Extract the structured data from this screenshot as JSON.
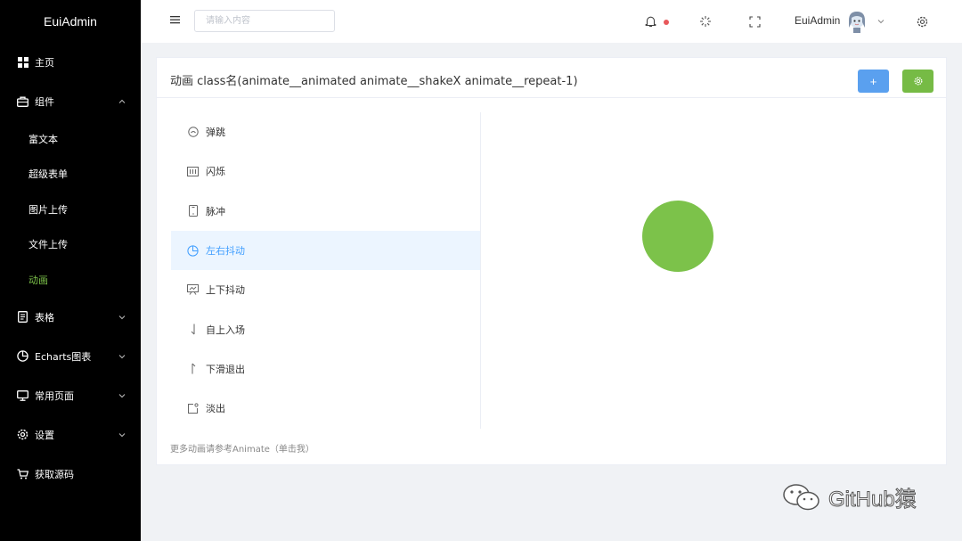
{
  "app": {
    "logo": "EuiAdmin"
  },
  "sidebar": {
    "items": [
      {
        "label": "主页",
        "icon": "home-grid-icon"
      },
      {
        "label": "组件",
        "icon": "briefcase-icon",
        "expanded": true,
        "children": [
          {
            "label": "富文本"
          },
          {
            "label": "超级表单"
          },
          {
            "label": "图片上传"
          },
          {
            "label": "文件上传"
          },
          {
            "label": "动画",
            "active": true
          }
        ]
      },
      {
        "label": "表格",
        "icon": "document-icon"
      },
      {
        "label": "Echarts图表",
        "icon": "pie-chart-icon"
      },
      {
        "label": "常用页面",
        "icon": "monitor-icon"
      },
      {
        "label": "设置",
        "icon": "gear-icon"
      },
      {
        "label": "获取源码",
        "icon": "cart-icon"
      }
    ],
    "active_color": "#7cc24a"
  },
  "header": {
    "search_placeholder": "请输入内容",
    "username": "EuiAdmin",
    "notification_dot_color": "#e8585b"
  },
  "card": {
    "title": "动画 class名(animate__animated animate__shakeX animate__repeat-1)",
    "add_button": "+",
    "list": [
      {
        "label": "弹跳",
        "icon": "smile-icon"
      },
      {
        "label": "闪烁",
        "icon": "barcode-icon"
      },
      {
        "label": "脉冲",
        "icon": "phone-icon"
      },
      {
        "label": "左右抖动",
        "icon": "clock-icon",
        "active": true
      },
      {
        "label": "上下抖动",
        "icon": "easel-icon"
      },
      {
        "label": "自上入场",
        "icon": "arrow-down-icon"
      },
      {
        "label": "下滑退出",
        "icon": "arrow-up-icon"
      },
      {
        "label": "淡出",
        "icon": "edit-icon"
      }
    ],
    "footer_link": "更多动画请参考Animate（单击我）",
    "circle_color": "#7cc24a"
  },
  "watermark": {
    "text": "GitHub猿"
  }
}
